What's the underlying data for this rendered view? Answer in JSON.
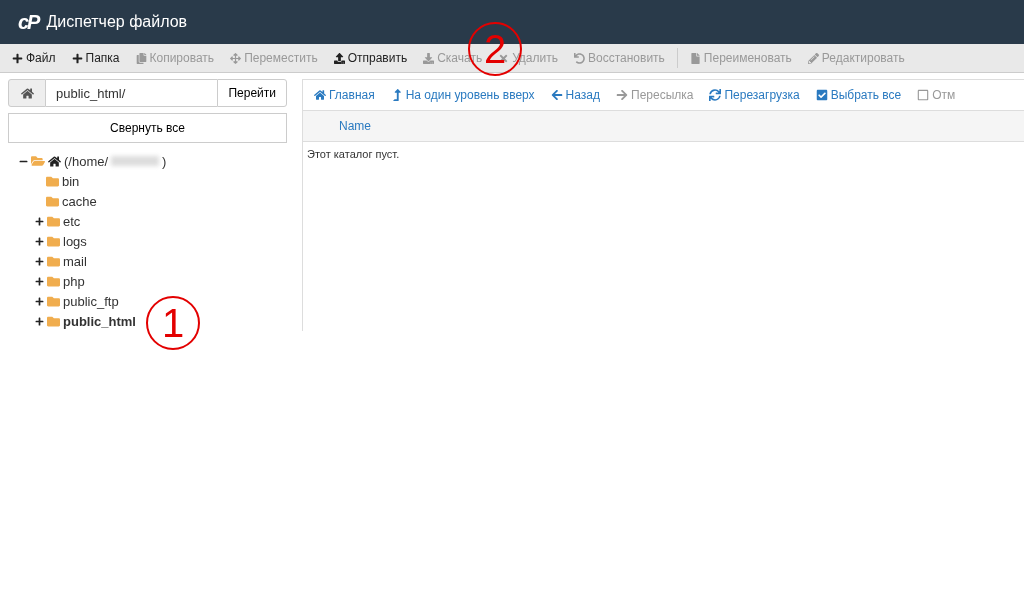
{
  "header": {
    "logo": "cP",
    "title": "Диспетчер файлов"
  },
  "toolbar": [
    {
      "label": "Файл",
      "disabled": false,
      "separator_before": false
    },
    {
      "label": "Папка",
      "disabled": false,
      "separator_before": false
    },
    {
      "label": "Копировать",
      "disabled": true,
      "separator_before": false
    },
    {
      "label": "Переместить",
      "disabled": true,
      "separator_before": false
    },
    {
      "label": "Отправить",
      "disabled": false,
      "separator_before": false
    },
    {
      "label": "Скачать",
      "disabled": true,
      "separator_before": false
    },
    {
      "label": "Удалить",
      "disabled": true,
      "separator_before": false
    },
    {
      "label": "Восстановить",
      "disabled": true,
      "separator_before": false
    },
    {
      "label": "Переименовать",
      "disabled": true,
      "separator_before": true
    },
    {
      "label": "Редактировать",
      "disabled": true,
      "separator_before": false
    }
  ],
  "path_bar": {
    "value": "public_html/",
    "go_button": "Перейти"
  },
  "collapse_button": "Свернуть все",
  "tree": {
    "prefix": "(/home/",
    "suffix": ")",
    "expanded": true,
    "children": [
      {
        "label": "bin",
        "selected": false
      },
      {
        "label": "cache",
        "selected": false
      },
      {
        "label": "etc",
        "expanded": false,
        "selected": false
      },
      {
        "label": "logs",
        "expanded": false,
        "selected": false
      },
      {
        "label": "mail",
        "expanded": false,
        "selected": false
      },
      {
        "label": "php",
        "expanded": false,
        "selected": false
      },
      {
        "label": "public_ftp",
        "expanded": false,
        "selected": false
      },
      {
        "label": "public_html",
        "expanded": false,
        "selected": true
      }
    ]
  },
  "nav": [
    {
      "label": "Главная",
      "disabled": false
    },
    {
      "label": "На один уровень вверх",
      "disabled": false
    },
    {
      "label": "Назад",
      "disabled": false
    },
    {
      "label": "Пересылка",
      "disabled": true
    },
    {
      "label": "Перезагрузка",
      "disabled": false
    },
    {
      "label": "Выбрать все",
      "disabled": false
    },
    {
      "label": "Отм",
      "disabled": true
    }
  ],
  "table": {
    "columns": [
      "Name"
    ],
    "empty_message": "Этот каталог пуст."
  },
  "annotations": [
    {
      "label": "1"
    },
    {
      "label": "2"
    }
  ]
}
